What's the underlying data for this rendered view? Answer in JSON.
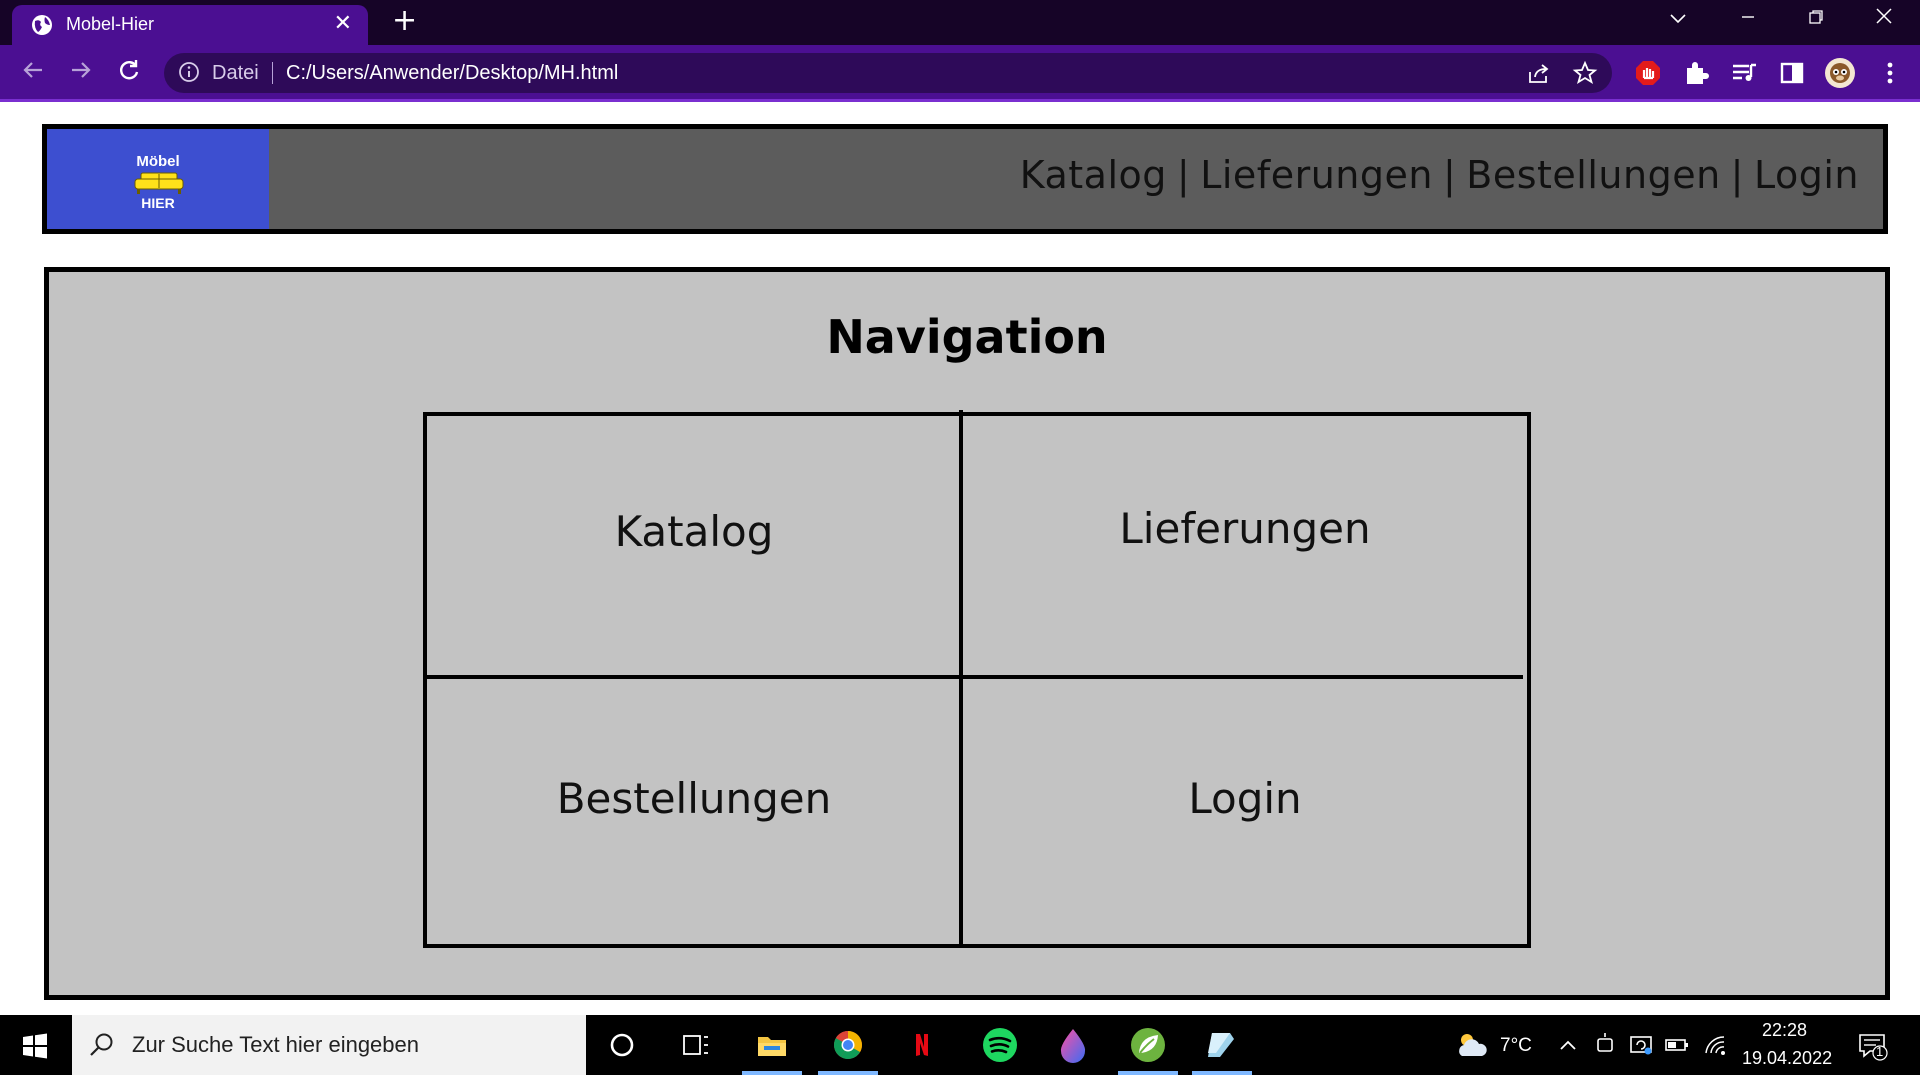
{
  "browser": {
    "tab_title": "Mobel-Hier",
    "tab_close": "✕",
    "new_tab": "+",
    "address_label": "Datei",
    "url": "C:/Users/Anwender/Desktop/MH.html"
  },
  "site": {
    "logo": {
      "top": "Möbel",
      "bottom": "HIER"
    },
    "topnav": {
      "items": [
        "Katalog",
        "Lieferungen",
        "Bestellungen",
        "Login"
      ],
      "separator": "|"
    },
    "navigation": {
      "title": "Navigation",
      "cells": [
        "Katalog",
        "Lieferungen",
        "Bestellungen",
        "Login"
      ]
    }
  },
  "taskbar": {
    "search_placeholder": "Zur Suche Text hier eingeben",
    "weather": "7°C",
    "time": "22:28",
    "date": "19.04.2022",
    "notification_count": "1"
  },
  "colors": {
    "chrome_dark": "#160427",
    "chrome_accent": "#4b0f92",
    "header_bg": "#5c5c5c",
    "logo_bg": "#3d4fd0",
    "section_bg": "#c3c3c3"
  }
}
